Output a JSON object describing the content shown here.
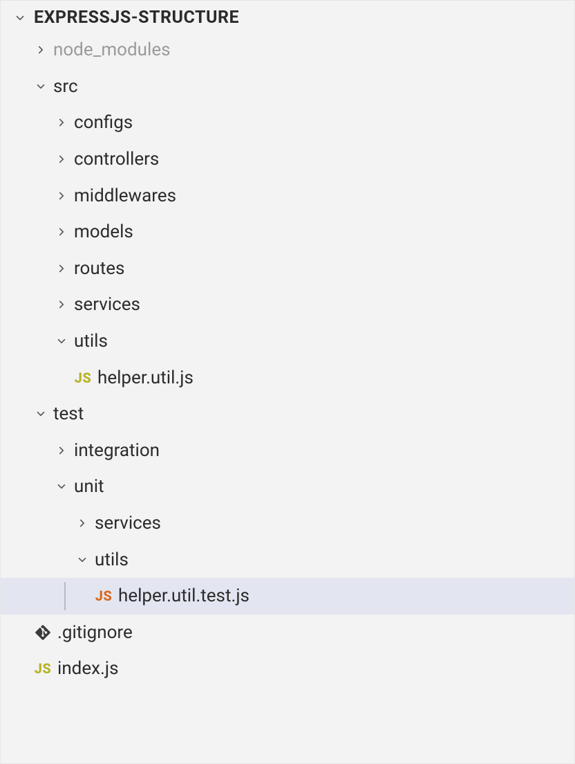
{
  "root": {
    "label": "EXPRESSJS-STRUCTURE"
  },
  "tree": {
    "node_modules": "node_modules",
    "src": {
      "label": "src",
      "configs": "configs",
      "controllers": "controllers",
      "middlewares": "middlewares",
      "models": "models",
      "routes": "routes",
      "services": "services",
      "utils": {
        "label": "utils",
        "helper_util": "helper.util.js"
      }
    },
    "test": {
      "label": "test",
      "integration": "integration",
      "unit": {
        "label": "unit",
        "services": "services",
        "utils": {
          "label": "utils",
          "helper_util_test": "helper.util.test.js"
        }
      }
    },
    "gitignore": ".gitignore",
    "index_js": "index.js"
  },
  "icons": {
    "js": "JS"
  }
}
